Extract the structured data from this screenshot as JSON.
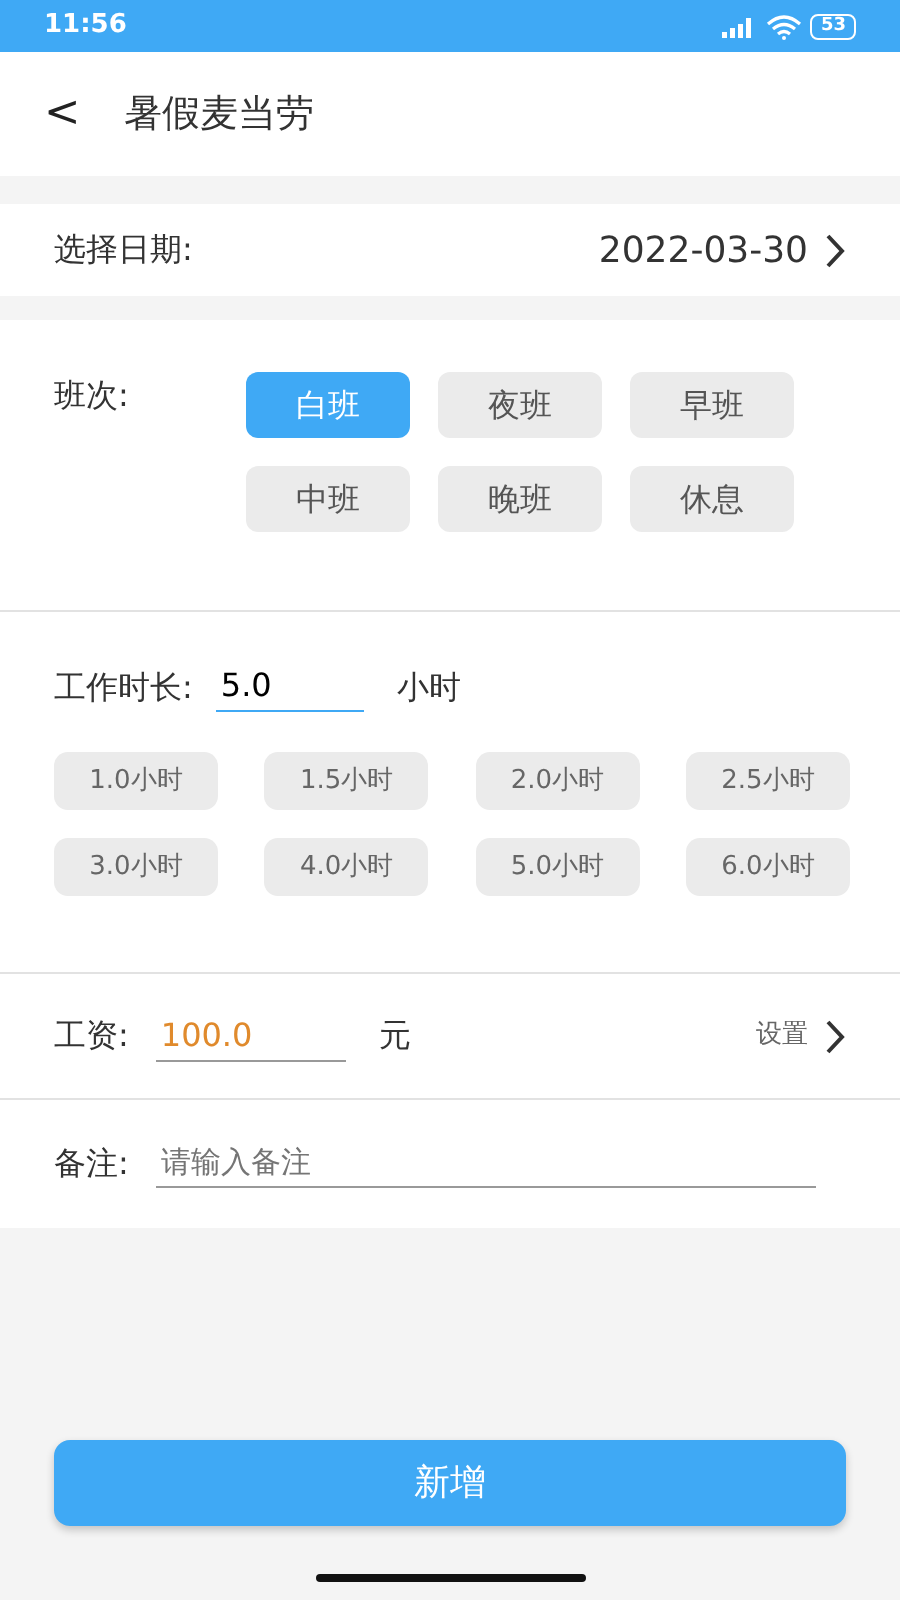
{
  "status_bar": {
    "time": "11:56",
    "battery": "53"
  },
  "header": {
    "back": "<",
    "title": "暑假麦当劳"
  },
  "date_row": {
    "label": "选择日期:",
    "value": "2022-03-30"
  },
  "shift": {
    "label": "班次:",
    "options": [
      {
        "label": "白班",
        "selected": true
      },
      {
        "label": "夜班",
        "selected": false
      },
      {
        "label": "早班",
        "selected": false
      },
      {
        "label": "中班",
        "selected": false
      },
      {
        "label": "晚班",
        "selected": false
      },
      {
        "label": "休息",
        "selected": false
      }
    ]
  },
  "hours": {
    "label": "工作时长:",
    "value": "5.0",
    "unit": "小时",
    "presets": [
      {
        "label": "1.0小时",
        "selected": false
      },
      {
        "label": "1.5小时",
        "selected": false
      },
      {
        "label": "2.0小时",
        "selected": false
      },
      {
        "label": "2.5小时",
        "selected": false
      },
      {
        "label": "3.0小时",
        "selected": false
      },
      {
        "label": "4.0小时",
        "selected": false
      },
      {
        "label": "5.0小时",
        "selected": false
      },
      {
        "label": "6.0小时",
        "selected": false
      }
    ]
  },
  "salary": {
    "label": "工资:",
    "value": "100.0",
    "unit": "元",
    "settings": "设置"
  },
  "remark": {
    "label": "备注:",
    "placeholder": "请输入备注"
  },
  "submit": {
    "label": "新增"
  }
}
